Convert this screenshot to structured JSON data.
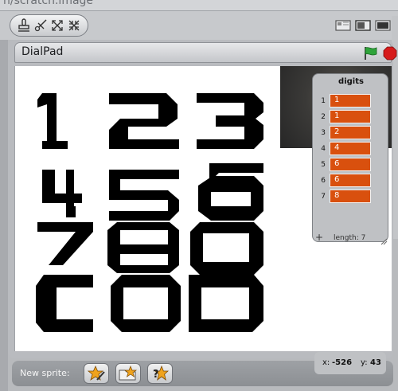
{
  "window": {
    "title_fragment": "n/scratch.image"
  },
  "toolbar": {
    "tools": [
      {
        "name": "stamp-icon"
      },
      {
        "name": "scissors-icon"
      },
      {
        "name": "grow-icon"
      },
      {
        "name": "shrink-icon"
      }
    ],
    "view_modes": [
      {
        "name": "small-stage-icon"
      },
      {
        "name": "normal-stage-icon"
      },
      {
        "name": "presentation-mode-icon"
      }
    ]
  },
  "stage": {
    "title": "DialPad",
    "go_icon": "green-flag-icon",
    "stop_icon": "stop-icon",
    "digit_glyphs": [
      "1",
      "2",
      "3",
      "4",
      "5",
      "6",
      "7",
      "8",
      "9",
      "C",
      "O",
      "D"
    ]
  },
  "list_monitor": {
    "title": "digits",
    "items": [
      {
        "index": "1",
        "value": "1"
      },
      {
        "index": "2",
        "value": "1"
      },
      {
        "index": "3",
        "value": "2"
      },
      {
        "index": "4",
        "value": "4"
      },
      {
        "index": "5",
        "value": "6"
      },
      {
        "index": "6",
        "value": "6"
      },
      {
        "index": "7",
        "value": "8"
      }
    ],
    "add_label": "+",
    "length_label": "length: 7"
  },
  "bottom_bar": {
    "new_sprite_label": "New sprite:",
    "buttons": [
      {
        "name": "paint-new-sprite-icon"
      },
      {
        "name": "choose-sprite-from-file-icon"
      },
      {
        "name": "random-sprite-icon"
      }
    ]
  },
  "mouse": {
    "x_label": "x:",
    "x_value": "-526",
    "y_label": "y:",
    "y_value": "43"
  },
  "colors": {
    "list_cell": "#d9500e",
    "flag": "#2fa43b",
    "stop": "#d61b1b"
  }
}
